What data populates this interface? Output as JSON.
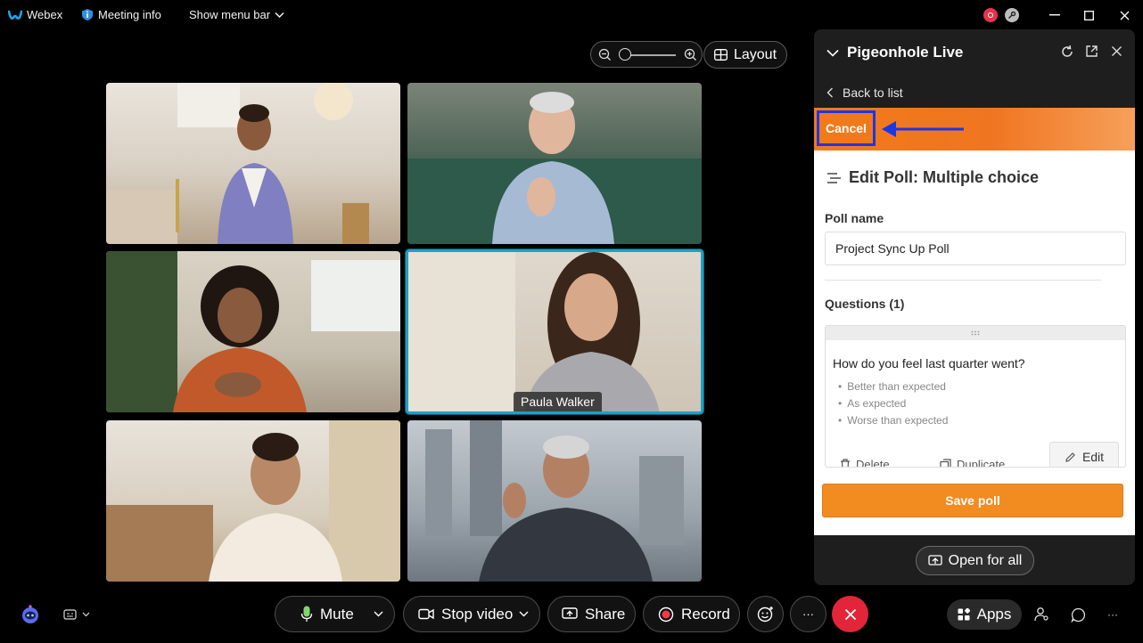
{
  "titlebar": {
    "app_name": "Webex",
    "meeting_info": "Meeting info",
    "show_menu_bar": "Show menu bar"
  },
  "toolbar_top": {
    "layout_label": "Layout"
  },
  "participants": [
    {
      "name": ""
    },
    {
      "name": ""
    },
    {
      "name": ""
    },
    {
      "name": "Paula Walker"
    },
    {
      "name": ""
    },
    {
      "name": ""
    }
  ],
  "panel": {
    "title": "Pigeonhole Live",
    "back_label": "Back to list",
    "cancel_label": "Cancel",
    "edit_title": "Edit Poll: Multiple choice",
    "poll_name_label": "Poll name",
    "poll_name_value": "Project Sync Up Poll",
    "questions_label": "Questions (1)",
    "question": {
      "text": "How do you feel last quarter went?",
      "options": [
        "Better than expected",
        "As expected",
        "Worse than expected"
      ]
    },
    "delete_label": "Delete",
    "duplicate_label": "Duplicate",
    "edit_label": "Edit",
    "save_label": "Save poll",
    "open_for_all_label": "Open for all"
  },
  "controls": {
    "mute": "Mute",
    "stop_video": "Stop video",
    "share": "Share",
    "record": "Record",
    "more": "···",
    "apps": "Apps"
  },
  "colors": {
    "accent_orange": "#f28c20",
    "active_border": "#1da1c5",
    "annotation_blue": "#1a37e8",
    "end_call_red": "#e3253a"
  }
}
